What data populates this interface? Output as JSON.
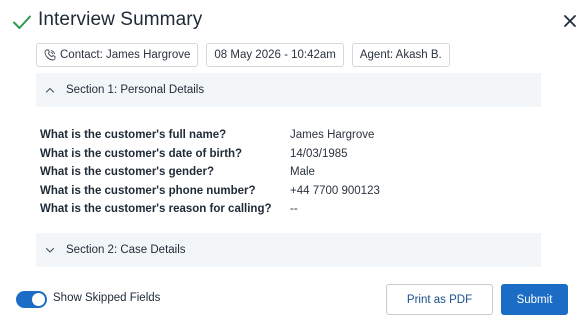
{
  "header": {
    "title": "Interview Summary",
    "check_icon": "check-icon",
    "close_icon": "close-icon",
    "accent_color": "#2e9c4e"
  },
  "chips": {
    "contact": "Contact: James Hargrove",
    "datetime": "08 May 2026 - 10:42am",
    "agent": "Agent: Akash B.",
    "contact_icon": "phone-icon"
  },
  "sections": [
    {
      "title": "Section 1: Personal Details",
      "expanded": true,
      "rows": [
        {
          "question": "What is the customer's full name?",
          "answer": "James Hargrove"
        },
        {
          "question": "What is the customer's date of birth?",
          "answer": "14/03/1985"
        },
        {
          "question": "What is the customer's gender?",
          "answer": "Male"
        },
        {
          "question": "What is the customer's phone number?",
          "answer": "+44 7700 900123"
        },
        {
          "question": "What is the customer's reason for calling?",
          "answer": "--"
        }
      ]
    },
    {
      "title": "Section 2: Case Details",
      "expanded": false
    }
  ],
  "footer": {
    "toggle_label": "Show Skipped Fields",
    "toggle_on": true,
    "print_label": "Print as PDF",
    "submit_label": "Submit",
    "primary_color": "#1a6cc4"
  }
}
